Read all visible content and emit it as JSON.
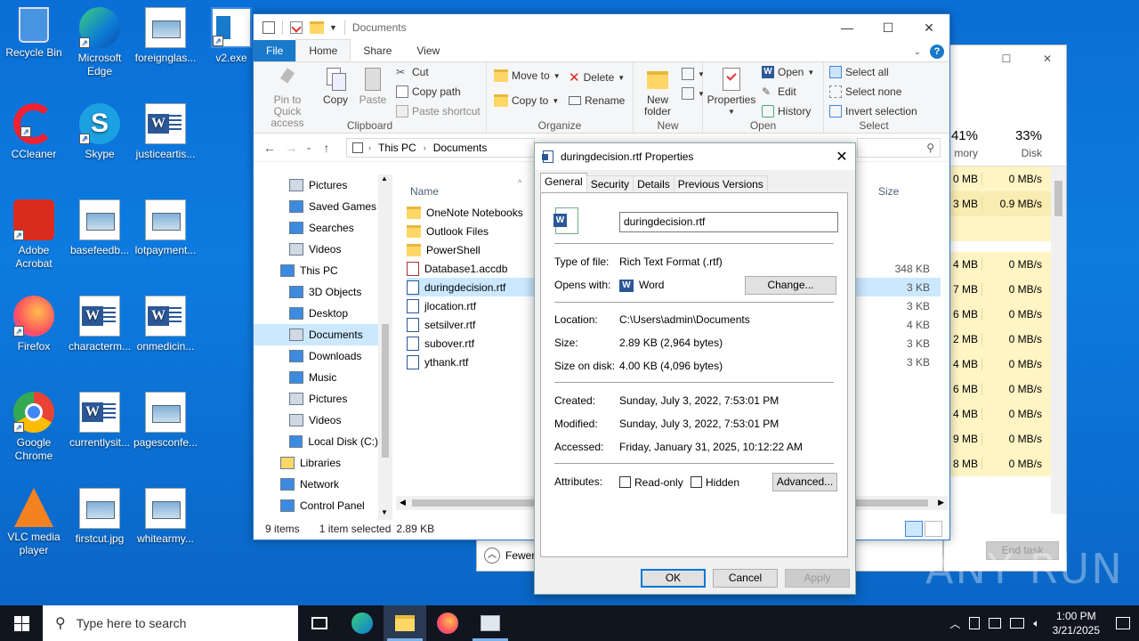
{
  "desktop": {
    "icons": [
      {
        "label": "Recycle Bin",
        "icon": "recycle-bin-icon"
      },
      {
        "label": "Microsoft Edge",
        "icon": "edge-icon"
      },
      {
        "label": "foreignglas...",
        "icon": "image-file-icon"
      },
      {
        "label": "v2.exe",
        "icon": "exe-icon"
      },
      {
        "label": "CCleaner",
        "icon": "ccleaner-icon"
      },
      {
        "label": "Skype",
        "icon": "skype-icon"
      },
      {
        "label": "justiceartis...",
        "icon": "word-doc-icon"
      },
      {
        "label": "Adobe Acrobat",
        "icon": "acrobat-icon"
      },
      {
        "label": "basefeedb...",
        "icon": "image-file-icon"
      },
      {
        "label": "lotpayment...",
        "icon": "image-file-icon"
      },
      {
        "label": "Firefox",
        "icon": "firefox-icon"
      },
      {
        "label": "characterm...",
        "icon": "word-doc-icon"
      },
      {
        "label": "onmedicin...",
        "icon": "word-doc-icon"
      },
      {
        "label": "Google Chrome",
        "icon": "chrome-icon"
      },
      {
        "label": "currentlysit...",
        "icon": "word-doc-icon"
      },
      {
        "label": "pagesconfe...",
        "icon": "image-file-icon"
      },
      {
        "label": "VLC media player",
        "icon": "vlc-icon"
      },
      {
        "label": "firstcut.jpg",
        "icon": "image-file-icon"
      },
      {
        "label": "whitearmy...",
        "icon": "image-file-icon"
      }
    ]
  },
  "explorer": {
    "title": "Documents",
    "tabs": {
      "file": "File",
      "home": "Home",
      "share": "Share",
      "view": "View"
    },
    "ribbon": {
      "clipboard": {
        "group": "Clipboard",
        "pin": "Pin to Quick access",
        "copy": "Copy",
        "paste": "Paste",
        "cut": "Cut",
        "copy_path": "Copy path",
        "paste_shortcut": "Paste shortcut"
      },
      "organize": {
        "group": "Organize",
        "move_to": "Move to",
        "copy_to": "Copy to",
        "delete": "Delete",
        "rename": "Rename"
      },
      "new": {
        "group": "New",
        "new_folder": "New folder"
      },
      "open": {
        "group": "Open",
        "properties": "Properties",
        "open": "Open",
        "edit": "Edit",
        "history": "History"
      },
      "select": {
        "group": "Select",
        "select_all": "Select all",
        "select_none": "Select none",
        "invert": "Invert selection"
      }
    },
    "breadcrumb": {
      "this_pc": "This PC",
      "documents": "Documents"
    },
    "nav": [
      {
        "label": "Pictures",
        "icon": "pictures-icon"
      },
      {
        "label": "Saved Games",
        "icon": "saved-games-icon"
      },
      {
        "label": "Searches",
        "icon": "search-icon"
      },
      {
        "label": "Videos",
        "icon": "videos-icon"
      },
      {
        "label": "This PC",
        "icon": "computer-icon"
      },
      {
        "label": "3D Objects",
        "icon": "3d-objects-icon"
      },
      {
        "label": "Desktop",
        "icon": "desktop-icon"
      },
      {
        "label": "Documents",
        "icon": "documents-icon"
      },
      {
        "label": "Downloads",
        "icon": "downloads-icon"
      },
      {
        "label": "Music",
        "icon": "music-icon"
      },
      {
        "label": "Pictures",
        "icon": "pictures-icon"
      },
      {
        "label": "Videos",
        "icon": "videos-icon"
      },
      {
        "label": "Local Disk (C:)",
        "icon": "disk-icon"
      },
      {
        "label": "Libraries",
        "icon": "libraries-icon"
      },
      {
        "label": "Network",
        "icon": "network-icon"
      },
      {
        "label": "Control Panel",
        "icon": "control-panel-icon"
      }
    ],
    "columns": {
      "name": "Name",
      "size": "Size"
    },
    "files": [
      {
        "name": "OneNote Notebooks",
        "icon": "folder-icon",
        "size": ""
      },
      {
        "name": "Outlook Files",
        "icon": "folder-icon",
        "size": ""
      },
      {
        "name": "PowerShell",
        "icon": "folder-icon",
        "size": ""
      },
      {
        "name": "Database1.accdb",
        "icon": "access-file-icon",
        "size": "348 KB"
      },
      {
        "name": "duringdecision.rtf",
        "icon": "rtf-file-icon",
        "size": "3 KB"
      },
      {
        "name": "jlocation.rtf",
        "icon": "rtf-file-icon",
        "size": "3 KB"
      },
      {
        "name": "setsilver.rtf",
        "icon": "rtf-file-icon",
        "size": "4 KB"
      },
      {
        "name": "subover.rtf",
        "icon": "rtf-file-icon",
        "size": "3 KB"
      },
      {
        "name": "ythank.rtf",
        "icon": "rtf-file-icon",
        "size": "3 KB"
      }
    ],
    "status": {
      "items": "9 items",
      "selected": "1 item selected",
      "size": "2.89 KB"
    }
  },
  "taskmgr": {
    "memory_pct": "41%",
    "memory_label": "mory",
    "disk_pct": "33%",
    "disk_label": "Disk",
    "rows": [
      {
        "mem": "0 MB",
        "disk": "0 MB/s"
      },
      {
        "mem": "3 MB",
        "disk": "0.9 MB/s"
      },
      {
        "mem": "",
        "disk": ""
      },
      {
        "mem": "4 MB",
        "disk": "0 MB/s"
      },
      {
        "mem": "7 MB",
        "disk": "0 MB/s"
      },
      {
        "mem": "6 MB",
        "disk": "0 MB/s"
      },
      {
        "mem": "2 MB",
        "disk": "0 MB/s"
      },
      {
        "mem": "4 MB",
        "disk": "0 MB/s"
      },
      {
        "mem": "6 MB",
        "disk": "0 MB/s"
      },
      {
        "mem": "4 MB",
        "disk": "0 MB/s"
      },
      {
        "mem": "9 MB",
        "disk": "0 MB/s"
      },
      {
        "mem": "8 MB",
        "disk": "0 MB/s"
      }
    ],
    "fewer": "Fewer",
    "end_task": "End task"
  },
  "props": {
    "title": "duringdecision.rtf Properties",
    "tabs": [
      "General",
      "Security",
      "Details",
      "Previous Versions"
    ],
    "filename": "duringdecision.rtf",
    "type_label": "Type of file:",
    "type_value": "Rich Text Format (.rtf)",
    "opens_label": "Opens with:",
    "opens_value": "Word",
    "change": "Change...",
    "location_label": "Location:",
    "location_value": "C:\\Users\\admin\\Documents",
    "size_label": "Size:",
    "size_value": "2.89 KB (2,964 bytes)",
    "sod_label": "Size on disk:",
    "sod_value": "4.00 KB (4,096 bytes)",
    "created_label": "Created:",
    "created_value": "Sunday, July 3, 2022, 7:53:01 PM",
    "modified_label": "Modified:",
    "modified_value": "Sunday, July 3, 2022, 7:53:01 PM",
    "accessed_label": "Accessed:",
    "accessed_value": "Friday, January 31, 2025, 10:12:22 AM",
    "attributes_label": "Attributes:",
    "readonly": "Read-only",
    "hidden": "Hidden",
    "advanced": "Advanced...",
    "ok": "OK",
    "cancel": "Cancel",
    "apply": "Apply"
  },
  "taskbar": {
    "search_placeholder": "Type here to search",
    "time": "1:00 PM",
    "date": "3/21/2025"
  },
  "watermark": "ANY RUN"
}
